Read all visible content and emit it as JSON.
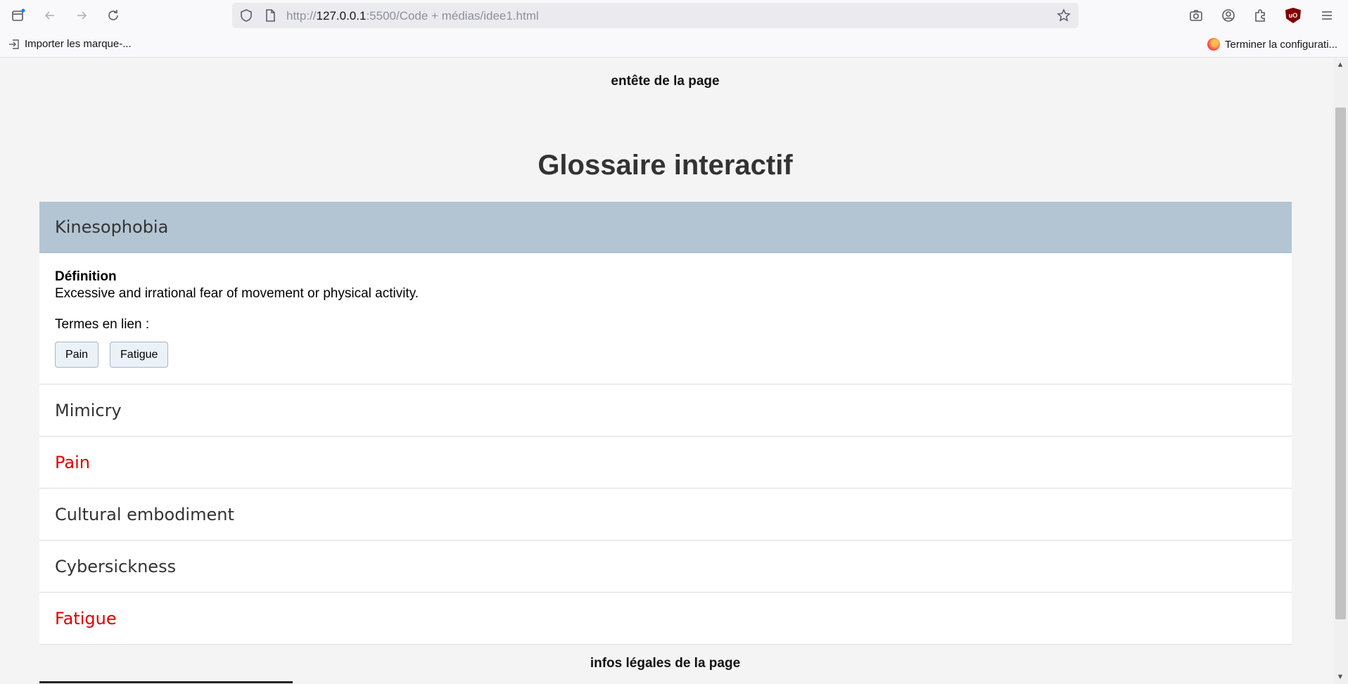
{
  "browser": {
    "url_prefix": "http://",
    "url_host": "127.0.0.1",
    "url_rest": ":5500/Code + médias/idee1.html",
    "bookmark_import": "Importer les marque-...",
    "bookmark_finish": "Terminer la configurati..."
  },
  "page": {
    "header": "entête de la page",
    "title": "Glossaire interactif",
    "footer": "infos légales de la page"
  },
  "glossary": {
    "open_term": {
      "name": "Kinesophobia",
      "definition_label": "Définition",
      "definition": "Excessive and irrational fear of movement or physical activity.",
      "related_label": "Termes en lien :",
      "related": [
        "Pain",
        "Fatigue"
      ]
    },
    "terms": [
      {
        "name": "Mimicry",
        "highlight": false
      },
      {
        "name": "Pain",
        "highlight": true
      },
      {
        "name": "Cultural embodiment",
        "highlight": false
      },
      {
        "name": "Cybersickness",
        "highlight": false
      },
      {
        "name": "Fatigue",
        "highlight": true
      }
    ]
  },
  "colors": {
    "active_header": "#b3c5d3",
    "highlight_text": "#e10000",
    "chip_bg": "#eaf1f7"
  }
}
